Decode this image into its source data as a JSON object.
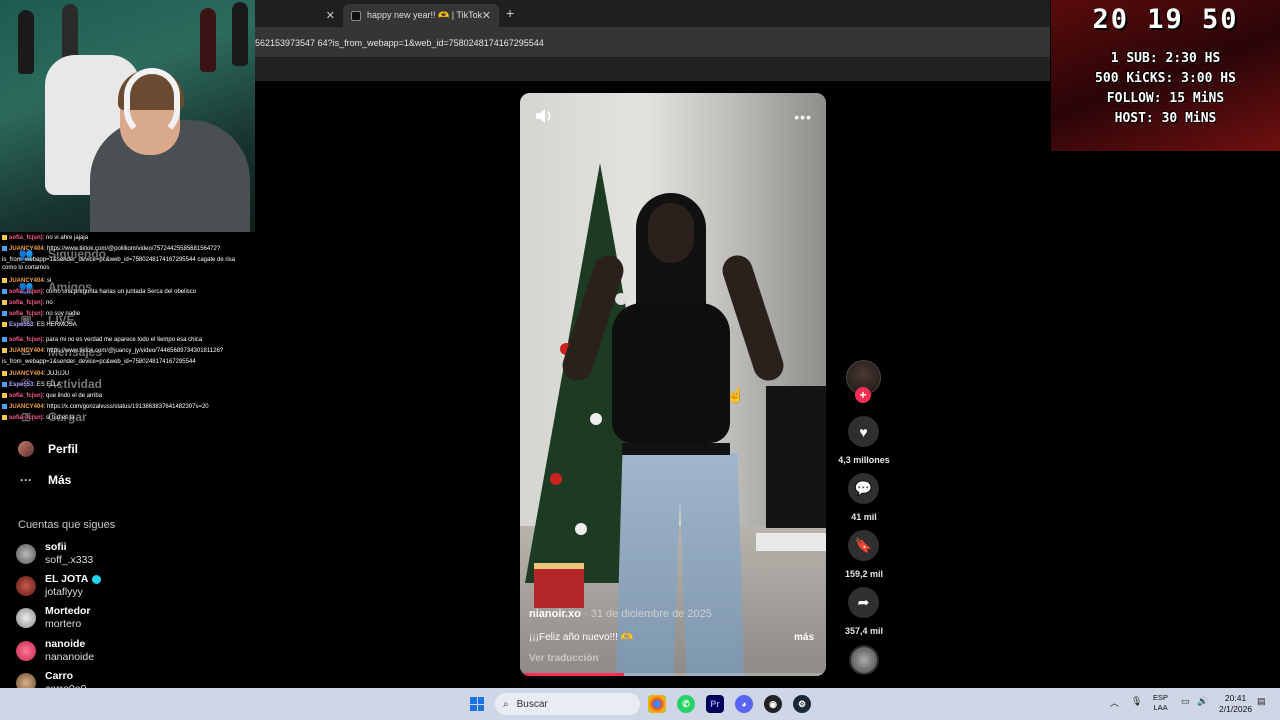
{
  "browser": {
    "tabs": [
      {
        "title": ""
      },
      {
        "title": "happy new year!! 🫶 | TikTok"
      }
    ],
    "url": "562153973547 64?is_from_webapp=1&web_id=7580248174167295544"
  },
  "subathon": {
    "timer": "20 19 50",
    "rules": [
      "1 SUB: 2:30 HS",
      "500 KiCKS: 3:00 HS",
      "FOLLOW: 15 MiNS",
      "HOST: 30 MiNS"
    ]
  },
  "nav": {
    "items": [
      {
        "label": "Siguiendo",
        "icon": "following-icon"
      },
      {
        "label": "Amigos",
        "icon": "friends-icon"
      },
      {
        "label": "LIVE",
        "icon": "live-icon"
      },
      {
        "label": "Mensajes",
        "icon": "messages-icon"
      },
      {
        "label": "Actividad",
        "icon": "activity-icon"
      },
      {
        "label": "Cargar",
        "icon": "upload-icon"
      },
      {
        "label": "Perfil",
        "icon": "profile-avatar"
      },
      {
        "label": "Más",
        "icon": "more-icon"
      }
    ],
    "following_header": "Cuentas que sigues",
    "following": [
      {
        "name": "sofii",
        "user": "soff_.x333"
      },
      {
        "name": "EL JOTA",
        "user": "jotaflyyy"
      },
      {
        "name": "Mortedor",
        "user": "mortero"
      },
      {
        "name": "nanoide",
        "user": "nananoide"
      },
      {
        "name": "Carro",
        "user": "carro0o0"
      }
    ]
  },
  "chat": [
    {
      "user": "sofia_fc(sn)",
      "text": ": no vi ahre jajaja"
    },
    {
      "user": "JUANCY404",
      "text": ": https://www.tiktok.com/@polilliom/video/7572442558568156472?"
    },
    {
      "user": "",
      "text": "is_from_webapp=1&sender_device=pc&web_id=7580248174167295544 cagate de risa"
    },
    {
      "user": "",
      "text": "como lo cortamos"
    },
    {
      "user": "JUANCY404",
      "text": ": si"
    },
    {
      "user": "sofia_fc(sn)",
      "text": ": como una pregunta harias un juntada Serca del obelisco"
    },
    {
      "user": "sofia_fc(sn)",
      "text": ": no"
    },
    {
      "user": "sofia_fc(sn)",
      "text": ": no soy nadie"
    },
    {
      "user": "Espe553",
      "text": ": ES HERMOSA"
    },
    {
      "user": "sofia_fc(sn)",
      "text": ": para mi no es verdad me aparece todo el tiempo esa chica"
    },
    {
      "user": "JUANCY404",
      "text": ": https://www.tiktok.com/@juancy_jy/video/7446568973430181126?"
    },
    {
      "user": "",
      "text": "is_from_webapp=1&sender_device=pc&web_id=7580248174167295544"
    },
    {
      "user": "JUANCY404",
      "text": ": JUJUJU"
    },
    {
      "user": "Espe553",
      "text": ": ES ELLA"
    },
    {
      "user": "sofia_fc(sn)",
      "text": ": que lindo el de arriba"
    },
    {
      "user": "JUANCY404",
      "text": ": https://x.com/gonzalvuss/status/1913863837641482307s=20"
    },
    {
      "user": "sofia_fc(sn)",
      "text": ": si bid es la"
    }
  ],
  "video": {
    "author": "nianoir.xo",
    "date": " · 31 de diciembre de 2025",
    "description": "¡¡¡Feliz año nuevo!!! 🫶",
    "more": "más",
    "translate": "Ver traducción",
    "progress": 0.34
  },
  "actions": {
    "likes": "4,3 millones",
    "comments": "41 mil",
    "saves": "159,2 mil",
    "shares": "357,4 mil"
  },
  "taskbar": {
    "search": "Buscar",
    "lang": [
      "ESP",
      "LAA"
    ],
    "time": "20:41",
    "date": "2/1/2026"
  },
  "colors": {
    "accent": "#fe2c55",
    "subathon_bg": "#5a0b0b"
  }
}
